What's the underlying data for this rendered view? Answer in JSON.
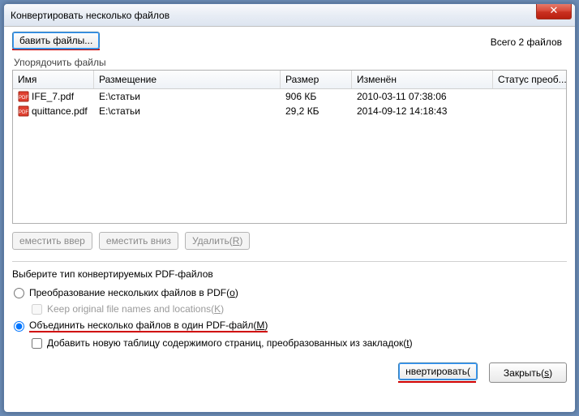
{
  "window": {
    "title": "Конвертировать несколько файлов",
    "close_glyph": "✕"
  },
  "header": {
    "add_files_label": "бавить файлы...",
    "total_label": "Всего 2 файлов"
  },
  "group_label": "Упорядочить файлы",
  "table": {
    "columns": {
      "name": "Имя",
      "location": "Размещение",
      "size": "Размер",
      "modified": "Изменён",
      "status": "Статус преоб..."
    },
    "rows": [
      {
        "name": "IFE_7.pdf",
        "location": "E:\\статьи",
        "size": "906 КБ",
        "modified": "2010-03-11 07:38:06",
        "status": ""
      },
      {
        "name": "quittance.pdf",
        "location": "E:\\статьи",
        "size": "29,2 КБ",
        "modified": "2014-09-12 14:18:43",
        "status": ""
      }
    ]
  },
  "toolbar": {
    "move_up": "еместить ввер",
    "move_down": "еместить вниз",
    "delete_pre": "Удалить(",
    "delete_u": "R",
    "delete_post": ")"
  },
  "options": {
    "label": "Выберите тип конвертируемых PDF-файлов",
    "radio1_pre": "Преобразование нескольких файлов в PDF(",
    "radio1_u": "o",
    "radio1_post": ")",
    "keep_pre": "Keep original file names and locations(",
    "keep_u": "K",
    "keep_post": ")",
    "radio2_pre": "Объединить несколько файлов в один PDF-файл(",
    "radio2_u": "M",
    "radio2_post": ")",
    "toc_pre": "Добавить новую таблицу содержимого страниц, преобразованных из закладок(",
    "toc_u": "t",
    "toc_post": ")"
  },
  "footer": {
    "convert": "нвертировать(",
    "close_pre": "Закрыть(",
    "close_u": "s",
    "close_post": ")"
  }
}
